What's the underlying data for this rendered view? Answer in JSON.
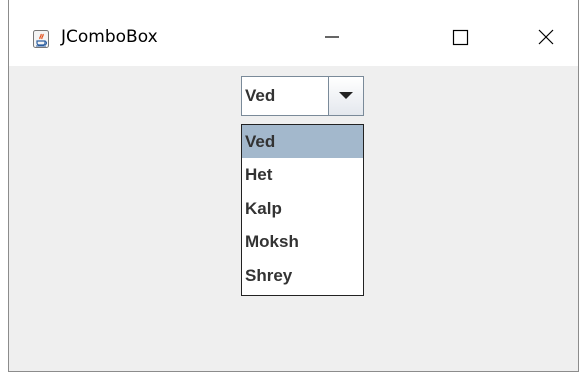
{
  "window": {
    "title": "JComboBox",
    "icon": "java-coffee-cup-icon",
    "controls": [
      "minimize-icon",
      "maximize-icon",
      "close-icon"
    ]
  },
  "combo": {
    "selected_value": "Ved",
    "arrow_icon": "triangle-down-icon",
    "options": [
      "Ved",
      "Het",
      "Kalp",
      "Moksh",
      "Shrey"
    ],
    "highlighted_index": 0
  },
  "colors": {
    "highlight": "#a3b8cc",
    "text": "#333333",
    "client_background": "#efefef"
  }
}
